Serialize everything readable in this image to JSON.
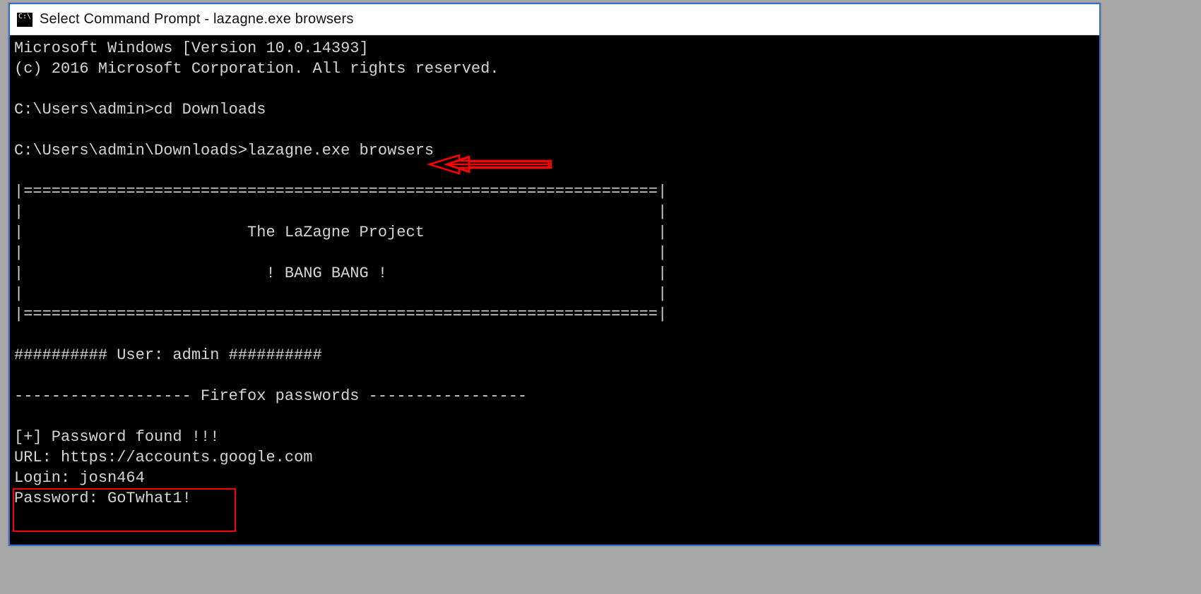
{
  "window": {
    "title": "Select Command Prompt - lazagne.exe  browsers"
  },
  "terminal": {
    "line1": "Microsoft Windows [Version 10.0.14393]",
    "line2": "(c) 2016 Microsoft Corporation. All rights reserved.",
    "blank1": "",
    "prompt1": "C:\\Users\\admin>cd Downloads",
    "blank2": "",
    "prompt2": "C:\\Users\\admin\\Downloads>lazagne.exe browsers",
    "blank3": "",
    "banner_top": "|====================================================================|",
    "banner_pad1": "|                                                                    |",
    "banner_title": "|                        The LaZagne Project                         |",
    "banner_pad2": "|                                                                    |",
    "banner_bang": "|                          ! BANG BANG !                             |",
    "banner_pad3": "|                                                                    |",
    "banner_bot": "|====================================================================|",
    "blank4": "",
    "user_header": "########## User: admin ##########",
    "blank5": "",
    "section": "------------------- Firefox passwords -----------------",
    "blank6": "",
    "found": "[+] Password found !!!",
    "url": "URL: https://accounts.google.com",
    "login": "Login: josn464",
    "password": "Password: GoTwhat1!"
  },
  "annotations": {
    "arrow_target": "lazagne.exe browsers command",
    "box_target": "login and password lines"
  }
}
